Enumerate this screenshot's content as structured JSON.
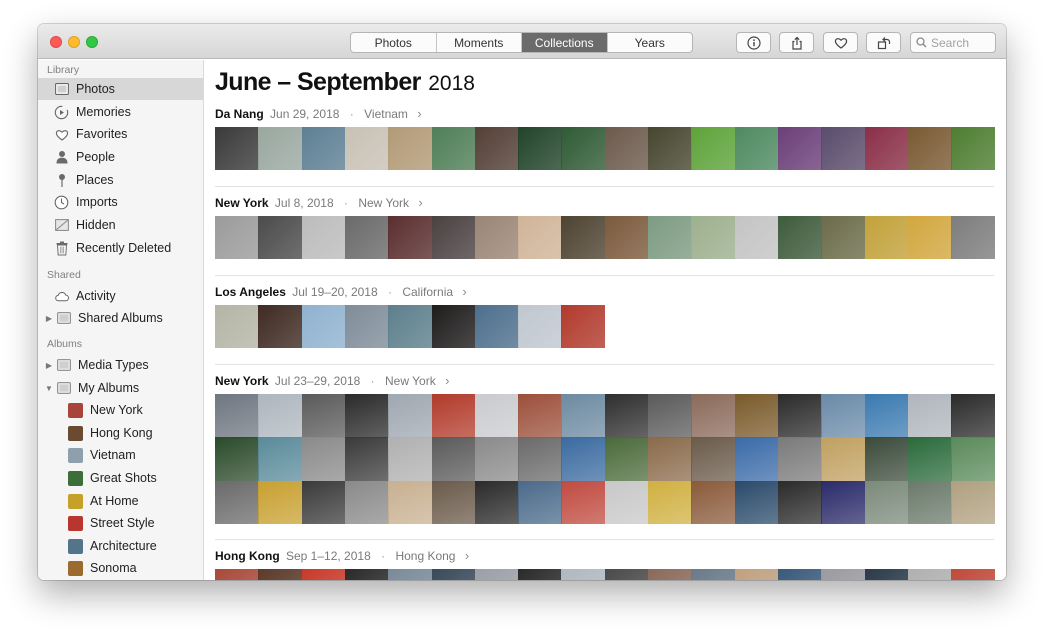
{
  "toolbar": {
    "tabs": [
      {
        "label": "Photos"
      },
      {
        "label": "Moments"
      },
      {
        "label": "Collections",
        "active": true
      },
      {
        "label": "Years"
      }
    ],
    "icons": [
      "info-icon",
      "share-icon",
      "heart-icon",
      "rotate-icon"
    ],
    "search_placeholder": "Search"
  },
  "sidebar": {
    "sections": {
      "library": "Library",
      "shared": "Shared",
      "albums": "Albums"
    },
    "library_items": [
      {
        "label": "Photos",
        "icon": "photos-icon",
        "selected": true
      },
      {
        "label": "Memories",
        "icon": "memories-icon"
      },
      {
        "label": "Favorites",
        "icon": "heart-icon"
      },
      {
        "label": "People",
        "icon": "person-icon"
      },
      {
        "label": "Places",
        "icon": "pin-icon"
      },
      {
        "label": "Imports",
        "icon": "clock-icon"
      },
      {
        "label": "Hidden",
        "icon": "hidden-icon"
      },
      {
        "label": "Recently Deleted",
        "icon": "trash-icon"
      }
    ],
    "shared_items": [
      {
        "label": "Activity",
        "icon": "cloud-icon"
      },
      {
        "label": "Shared Albums",
        "icon": "album-icon",
        "disclosure": "collapsed"
      }
    ],
    "album_items": [
      {
        "label": "Media Types",
        "icon": "album-icon",
        "disclosure": "collapsed"
      },
      {
        "label": "My Albums",
        "icon": "album-icon",
        "disclosure": "expanded"
      }
    ],
    "my_albums": [
      {
        "label": "New York",
        "color": "#a8453a"
      },
      {
        "label": "Hong Kong",
        "color": "#6a4a30"
      },
      {
        "label": "Vietnam",
        "color": "#8fa0ad"
      },
      {
        "label": "Great Shots",
        "color": "#3c6e3a"
      },
      {
        "label": "At Home",
        "color": "#c6a12a"
      },
      {
        "label": "Street Style",
        "color": "#b8362d"
      },
      {
        "label": "Architecture",
        "color": "#54748a"
      },
      {
        "label": "Sonoma",
        "color": "#9a6a2e"
      }
    ]
  },
  "main": {
    "title": "June – September",
    "year": "2018",
    "collections": [
      {
        "name": "Da Nang",
        "date": "Jun 29, 2018",
        "location": "Vietnam",
        "colors": [
          "#3a3a3a",
          "#9aa8a0",
          "#5d7f93",
          "#c8c1b5",
          "#b29a76",
          "#4f7f57",
          "#533f36",
          "#214429",
          "#2f5a34",
          "#6c5a4c",
          "#46462f",
          "#5ea33a",
          "#4e8a61",
          "#6b3f79",
          "#5a4c6c",
          "#8a2f47",
          "#7a5a34",
          "#4e7d30"
        ]
      },
      {
        "name": "New York",
        "date": "Jul 8, 2018",
        "location": "New York",
        "colors": [
          "#9b9b9b",
          "#4b4b4b",
          "#bcbcbc",
          "#6a6a6a",
          "#5a2e2e",
          "#4a4141",
          "#9a8576",
          "#d0b499",
          "#4e4331",
          "#7b5a3c",
          "#7d9b82",
          "#9db08e",
          "#c4c4c4",
          "#3e5b3c",
          "#6b6b4a",
          "#c2a23a",
          "#d2a73f",
          "#7d7d7d"
        ]
      },
      {
        "name": "Los Angeles",
        "date": "Jul 19–20, 2018",
        "location": "California",
        "colors": [
          "#b4b5a5",
          "#3f2a22",
          "#8fb2cf",
          "#7f8d99",
          "#5c7f8c",
          "#1e1b1b",
          "#4d6f8d",
          "#c0c7cf",
          "#b13a2c"
        ]
      },
      {
        "name": "New York",
        "date": "Jul 23–29, 2018",
        "location": "New York",
        "grid": [
          [
            "#6e7680",
            "#aeb6be",
            "#5a5a5a",
            "#2a2a2a",
            "#9fa7b0",
            "#b13a2a",
            "#c9cbce",
            "#9c4f3a",
            "#6d8aa1",
            "#2e2e2e",
            "#5a5a5a",
            "#8a6a5a",
            "#7a5a2a",
            "#2a2a2a",
            "#6a8aa8",
            "#3a7ab0",
            "#b0b6bc",
            "#2a2a2a"
          ],
          [
            "#2a4a2a",
            "#5a8a9a",
            "#8a8a8a",
            "#3a3a3a",
            "#b0b0b0",
            "#5a5a5a",
            "#8a8a8a",
            "#6a6a6a",
            "#3a6aa0",
            "#4a6a3a",
            "#8a6a4a",
            "#6a5a4a",
            "#3a6aa8",
            "#7a7a7a",
            "#c0a060",
            "#3a4a3a",
            "#2a6a3a",
            "#5a8a5a"
          ],
          [
            "#6a6a6a",
            "#c8a030",
            "#3a3a3a",
            "#8a8a8a",
            "#c8b090",
            "#6a5a4a",
            "#2a2a2a",
            "#4a6a8a",
            "#c04a40",
            "#c8c8c8",
            "#d0b040",
            "#8a5a3a",
            "#2a4a6a",
            "#2a2a2a",
            "#2a2a6a",
            "#7a8a7a",
            "#6a7a6a",
            "#b0a080"
          ]
        ]
      },
      {
        "name": "Hong Kong",
        "date": "Sep 1–12, 2018",
        "location": "Hong Kong",
        "colors": [
          "#a84a3a",
          "#5a3a2a",
          "#c83a2a",
          "#2a2a2a",
          "#7a8a9a",
          "#3a4a5a",
          "#9aa0a6",
          "#2a2a2a",
          "#b0b8c0",
          "#4a4a4a",
          "#8a6a5a",
          "#6a7a8a",
          "#c0a080",
          "#3a5a7a",
          "#9a9aa0",
          "#2a3a4a",
          "#b0b0b0",
          "#c04a3a"
        ]
      }
    ]
  }
}
